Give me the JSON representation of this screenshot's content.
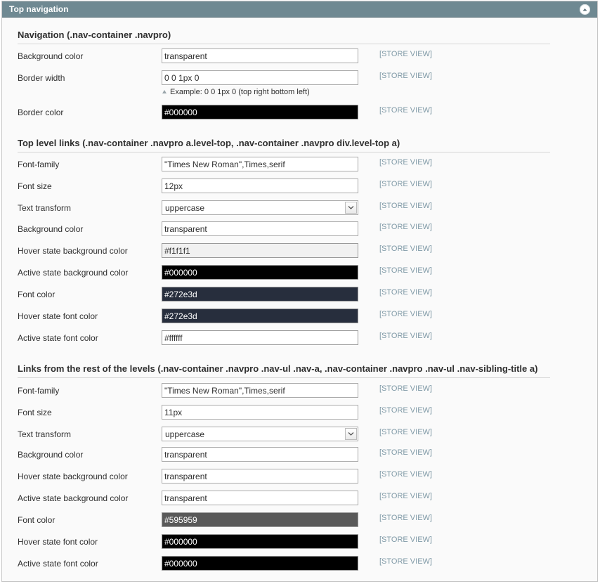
{
  "panel": {
    "title": "Top navigation"
  },
  "sections": [
    {
      "title": "Navigation (.nav-container .navpro)",
      "rows": [
        {
          "label": "Background color",
          "value": "transparent",
          "kind": "text",
          "bg": "#ffffff",
          "fg": "#2f2f2f",
          "scope": "[STORE VIEW]"
        },
        {
          "label": "Border width",
          "value": "0 0 1px 0",
          "kind": "text",
          "bg": "#ffffff",
          "fg": "#2f2f2f",
          "scope": "[STORE VIEW]",
          "note": "Example: 0 0 1px 0 (top right bottom left)"
        },
        {
          "label": "Border color",
          "value": "#000000",
          "kind": "color",
          "bg": "#000000",
          "fg": "#ffffff",
          "scope": "[STORE VIEW]"
        }
      ]
    },
    {
      "title": "Top level links (.nav-container .navpro a.level-top, .nav-container .navpro div.level-top a)",
      "rows": [
        {
          "label": "Font-family",
          "value": "\"Times New Roman\",Times,serif",
          "kind": "text",
          "bg": "#ffffff",
          "fg": "#2f2f2f",
          "scope": "[STORE VIEW]"
        },
        {
          "label": "Font size",
          "value": "12px",
          "kind": "text",
          "bg": "#ffffff",
          "fg": "#2f2f2f",
          "scope": "[STORE VIEW]"
        },
        {
          "label": "Text transform",
          "value": "uppercase",
          "kind": "select",
          "bg": "#ffffff",
          "fg": "#2f2f2f",
          "scope": "[STORE VIEW]"
        },
        {
          "label": "Background color",
          "value": "transparent",
          "kind": "text",
          "bg": "#ffffff",
          "fg": "#2f2f2f",
          "scope": "[STORE VIEW]"
        },
        {
          "label": "Hover state background color",
          "value": "#f1f1f1",
          "kind": "color",
          "bg": "#f1f1f1",
          "fg": "#2f2f2f",
          "scope": "[STORE VIEW]"
        },
        {
          "label": "Active state background color",
          "value": "#000000",
          "kind": "color",
          "bg": "#000000",
          "fg": "#ffffff",
          "scope": "[STORE VIEW]"
        },
        {
          "label": "Font color",
          "value": "#272e3d",
          "kind": "color",
          "bg": "#272e3d",
          "fg": "#ffffff",
          "scope": "[STORE VIEW]"
        },
        {
          "label": "Hover state font color",
          "value": "#272e3d",
          "kind": "color",
          "bg": "#272e3d",
          "fg": "#ffffff",
          "scope": "[STORE VIEW]"
        },
        {
          "label": "Active state font color",
          "value": "#ffffff",
          "kind": "color",
          "bg": "#ffffff",
          "fg": "#2f2f2f",
          "scope": "[STORE VIEW]"
        }
      ]
    },
    {
      "title": "Links from the rest of the levels (.nav-container .navpro .nav-ul .nav-a, .nav-container .navpro .nav-ul .nav-sibling-title a)",
      "rows": [
        {
          "label": "Font-family",
          "value": "\"Times New Roman\",Times,serif",
          "kind": "text",
          "bg": "#ffffff",
          "fg": "#2f2f2f",
          "scope": "[STORE VIEW]"
        },
        {
          "label": "Font size",
          "value": "11px",
          "kind": "text",
          "bg": "#ffffff",
          "fg": "#2f2f2f",
          "scope": "[STORE VIEW]"
        },
        {
          "label": "Text transform",
          "value": "uppercase",
          "kind": "select",
          "bg": "#ffffff",
          "fg": "#2f2f2f",
          "scope": "[STORE VIEW]"
        },
        {
          "label": "Background color",
          "value": "transparent",
          "kind": "text",
          "bg": "#ffffff",
          "fg": "#2f2f2f",
          "scope": "[STORE VIEW]"
        },
        {
          "label": "Hover state background color",
          "value": "transparent",
          "kind": "text",
          "bg": "#ffffff",
          "fg": "#2f2f2f",
          "scope": "[STORE VIEW]"
        },
        {
          "label": "Active state background color",
          "value": "transparent",
          "kind": "text",
          "bg": "#ffffff",
          "fg": "#2f2f2f",
          "scope": "[STORE VIEW]"
        },
        {
          "label": "Font color",
          "value": "#595959",
          "kind": "color",
          "bg": "#595959",
          "fg": "#ffffff",
          "scope": "[STORE VIEW]"
        },
        {
          "label": "Hover state font color",
          "value": "#000000",
          "kind": "color",
          "bg": "#000000",
          "fg": "#ffffff",
          "scope": "[STORE VIEW]"
        },
        {
          "label": "Active state font color",
          "value": "#000000",
          "kind": "color",
          "bg": "#000000",
          "fg": "#ffffff",
          "scope": "[STORE VIEW]"
        }
      ]
    }
  ]
}
